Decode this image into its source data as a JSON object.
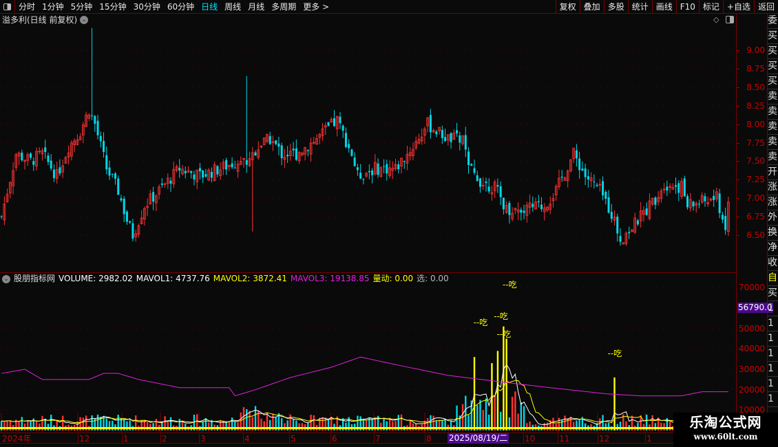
{
  "toolbar": {
    "periods": [
      "分时",
      "1分钟",
      "5分钟",
      "15分钟",
      "30分钟",
      "60分钟",
      "日线",
      "周线",
      "月线",
      "多周期",
      "更多 >"
    ],
    "active_period": "日线",
    "right_buttons": [
      "复权",
      "叠加",
      "多股",
      "统计",
      "画线",
      "F10",
      "标记",
      "+自选",
      "返回"
    ]
  },
  "main": {
    "title": "溢多利(日线 前复权)",
    "price_ticks": [
      "9.00",
      "8.75",
      "8.50",
      "8.25",
      "8.00",
      "7.75",
      "7.50",
      "7.25",
      "7.00",
      "6.75",
      "6.50"
    ]
  },
  "indicator": {
    "name": "股朋指标网",
    "volume": "VOLUME: 2982.02",
    "mavol1": "MAVOL1: 4737.76",
    "mavol2": "MAVOL2: 3872.41",
    "mavol3": "MAVOL3: 19138.85",
    "liangdong": "量动: 0.00",
    "xuan": "选: 0.00",
    "ticks": [
      "70000",
      "50000",
      "40000",
      "30000",
      "20000",
      "10000"
    ],
    "current_value": "56790.05",
    "signal_label": "--吃"
  },
  "dates": {
    "labels": [
      "2024年",
      "12",
      "1",
      "2",
      "3",
      "4",
      "5",
      "6",
      "7",
      "8",
      "10",
      "11",
      "12",
      "1"
    ],
    "selected": "2025/08/19/二"
  },
  "side_panel": [
    "委",
    "买",
    "买",
    "买",
    "买",
    "卖",
    "卖",
    "卖",
    "卖",
    "卖",
    "开",
    "涨",
    "涨",
    "外",
    "换",
    "净",
    "收",
    "自",
    "买",
    "1",
    "1",
    "1",
    "1",
    "1",
    "1",
    "1"
  ],
  "watermark": {
    "name": "乐淘公式网",
    "url": "www.60lt.com"
  },
  "colors": {
    "up": "#ff3333",
    "down": "#00d8e8",
    "mavol1": "#ffffff",
    "mavol2": "#ffff00",
    "mavol3": "#e020e0",
    "accent": "#00e5ff"
  },
  "chart_data": {
    "type": "candlestick+volume",
    "price_range": [
      6.3,
      9.3
    ],
    "close_anchors": [
      [
        0,
        6.75
      ],
      [
        5,
        7.6
      ],
      [
        10,
        7.5
      ],
      [
        14,
        7.6
      ],
      [
        19,
        7.3
      ],
      [
        23,
        7.7
      ],
      [
        27,
        7.9
      ],
      [
        30,
        8.2
      ],
      [
        32,
        8.0
      ],
      [
        36,
        7.4
      ],
      [
        40,
        7.1
      ],
      [
        43,
        6.7
      ],
      [
        45,
        6.5
      ],
      [
        49,
        6.9
      ],
      [
        54,
        7.1
      ],
      [
        61,
        7.4
      ],
      [
        68,
        7.3
      ],
      [
        75,
        7.4
      ],
      [
        81,
        7.5
      ],
      [
        84,
        7.5
      ],
      [
        88,
        7.7
      ],
      [
        92,
        7.8
      ],
      [
        96,
        7.6
      ],
      [
        101,
        7.6
      ],
      [
        108,
        7.8
      ],
      [
        115,
        8.05
      ],
      [
        120,
        7.6
      ],
      [
        122,
        7.3
      ],
      [
        128,
        7.4
      ],
      [
        135,
        7.4
      ],
      [
        141,
        7.7
      ],
      [
        146,
        8.0
      ],
      [
        153,
        7.8
      ],
      [
        158,
        7.8
      ],
      [
        160,
        7.4
      ],
      [
        165,
        7.2
      ],
      [
        169,
        7.15
      ],
      [
        173,
        6.85
      ],
      [
        179,
        6.85
      ],
      [
        186,
        6.9
      ],
      [
        190,
        7.1
      ],
      [
        196,
        7.6
      ],
      [
        200,
        7.3
      ],
      [
        205,
        7.1
      ],
      [
        209,
        6.8
      ],
      [
        212,
        6.45
      ],
      [
        216,
        6.6
      ],
      [
        220,
        6.8
      ],
      [
        224,
        7.0
      ],
      [
        227,
        7.2
      ],
      [
        233,
        7.15
      ],
      [
        235,
        6.9
      ],
      [
        240,
        6.95
      ],
      [
        245,
        7.0
      ],
      [
        248,
        6.6
      ],
      [
        249,
        6.9
      ]
    ],
    "volume_range": [
      0,
      75000
    ],
    "volume_spikes": [
      [
        87,
        12000
      ],
      [
        162,
        36000
      ],
      [
        168,
        33000
      ],
      [
        170,
        39000
      ],
      [
        172,
        51000
      ],
      [
        173,
        45000
      ],
      [
        210,
        26000
      ]
    ],
    "mavol3_anchors": [
      [
        0,
        28000
      ],
      [
        8,
        30000
      ],
      [
        14,
        25000
      ],
      [
        30,
        25000
      ],
      [
        35,
        28000
      ],
      [
        40,
        28000
      ],
      [
        47,
        25000
      ],
      [
        61,
        21000
      ],
      [
        78,
        21000
      ],
      [
        80,
        17000
      ],
      [
        87,
        20000
      ],
      [
        99,
        26000
      ],
      [
        113,
        31000
      ],
      [
        123,
        36000
      ],
      [
        136,
        32000
      ],
      [
        153,
        27000
      ],
      [
        176,
        23000
      ],
      [
        188,
        21000
      ],
      [
        207,
        18000
      ],
      [
        219,
        17000
      ],
      [
        233,
        17000
      ],
      [
        240,
        19000
      ],
      [
        249,
        19000
      ]
    ],
    "signals": [
      165,
      172,
      173,
      175,
      211
    ]
  }
}
